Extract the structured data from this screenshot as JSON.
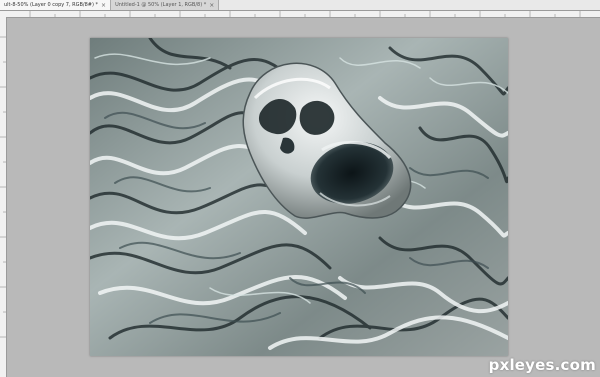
{
  "tabs": [
    {
      "label": "ult-8-50% (Layer 0 copy 7, RGB/8#) *",
      "active": true
    },
    {
      "label": "Untitled-1 @ 50% (Layer 1, RGB/8) *",
      "active": false
    }
  ],
  "tab_close": "×",
  "watermark": "pxleyes.com",
  "colors": {
    "workspace": "#b9b9b9",
    "tab_bar": "#e9e9e9",
    "ruler": "#f1f1f1",
    "artwork_base": "#8d9a99"
  },
  "icons": {
    "tab_close": "close-icon"
  }
}
